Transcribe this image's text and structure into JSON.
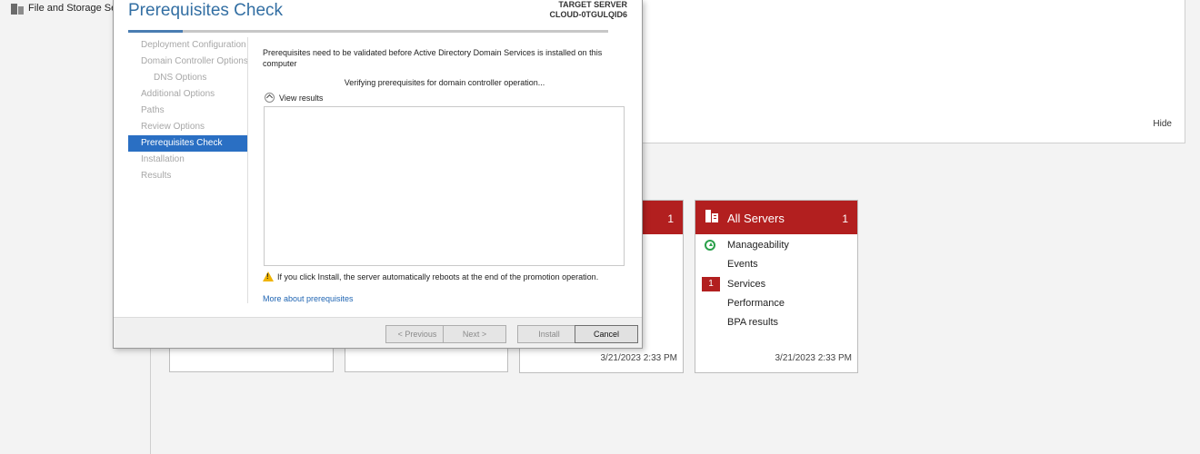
{
  "server_manager": {
    "sidebar": {
      "items": [
        {
          "label": "File and Storage Ser",
          "icon": "file-storage-icon"
        }
      ]
    },
    "welcome": {
      "hide_label": "Hide"
    },
    "tiles": [
      {
        "count": "1",
        "timestamp": "3/21/2023 2:33 PM"
      },
      {
        "title": "All Servers",
        "count": "1",
        "icon": "servers-icon",
        "rows": [
          {
            "label": "Manageability",
            "status": "up-arrow-icon"
          },
          {
            "label": "Events"
          },
          {
            "label": "Services",
            "badge": "1"
          },
          {
            "label": "Performance"
          },
          {
            "label": "BPA results"
          }
        ],
        "timestamp": "3/21/2023 2:33 PM"
      }
    ]
  },
  "wizard": {
    "title": "Prerequisites Check",
    "target_label": "TARGET SERVER",
    "target_server": "CLOUD-0TGULQID6",
    "nav": [
      {
        "label": "Deployment Configuration"
      },
      {
        "label": "Domain Controller Options"
      },
      {
        "label": "DNS Options"
      },
      {
        "label": "Additional Options"
      },
      {
        "label": "Paths"
      },
      {
        "label": "Review Options"
      },
      {
        "label": "Prerequisites Check"
      },
      {
        "label": "Installation"
      },
      {
        "label": "Results"
      }
    ],
    "description": "Prerequisites need to be validated before Active Directory Domain Services is installed on this computer",
    "verifying": "Verifying prerequisites for domain controller operation...",
    "view_results": "View results",
    "warning": "If you click Install, the server automatically reboots at the end of the promotion operation.",
    "more_link": "More about prerequisites",
    "buttons": {
      "previous": "< Previous",
      "next": "Next >",
      "install": "Install",
      "cancel": "Cancel"
    }
  }
}
